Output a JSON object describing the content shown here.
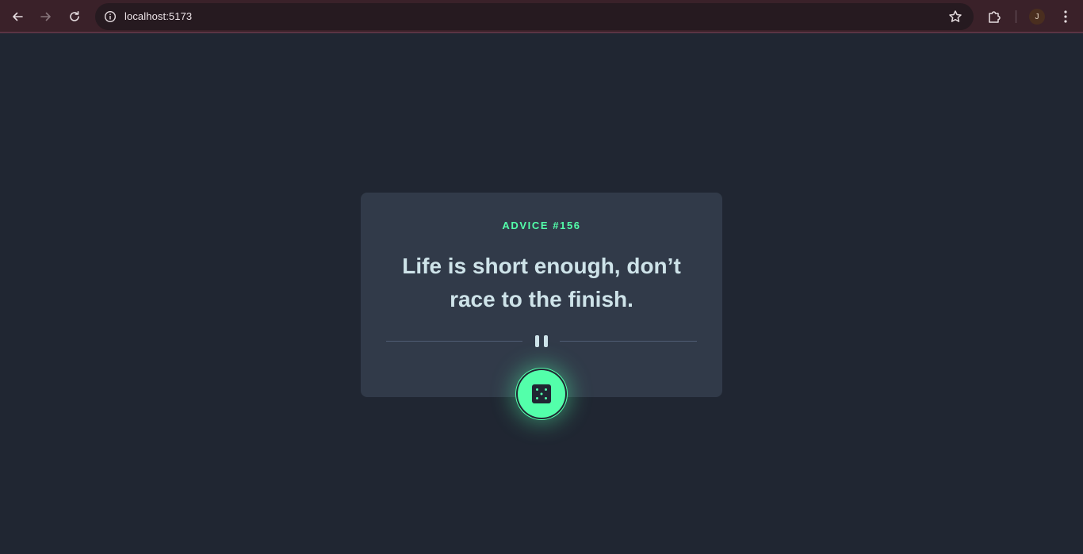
{
  "browser": {
    "url": "localhost:5173",
    "profile_initial": "J",
    "colors": {
      "toolbar": "#3a2129",
      "omnibox": "#261a20"
    },
    "icons": [
      "back-arrow-icon",
      "forward-arrow-icon",
      "reload-icon",
      "info-icon",
      "star-icon",
      "extensions-icon",
      "kebab-menu-icon"
    ]
  },
  "advice": {
    "id_label": "ADVICE #156",
    "text": "Life is short enough, don’t race to the finish.",
    "colors": {
      "accent": "#53ffaa",
      "text": "#cee3e9",
      "card": "#313a49",
      "background": "#202632"
    },
    "icons": [
      "pause-icon",
      "dice-icon"
    ]
  }
}
